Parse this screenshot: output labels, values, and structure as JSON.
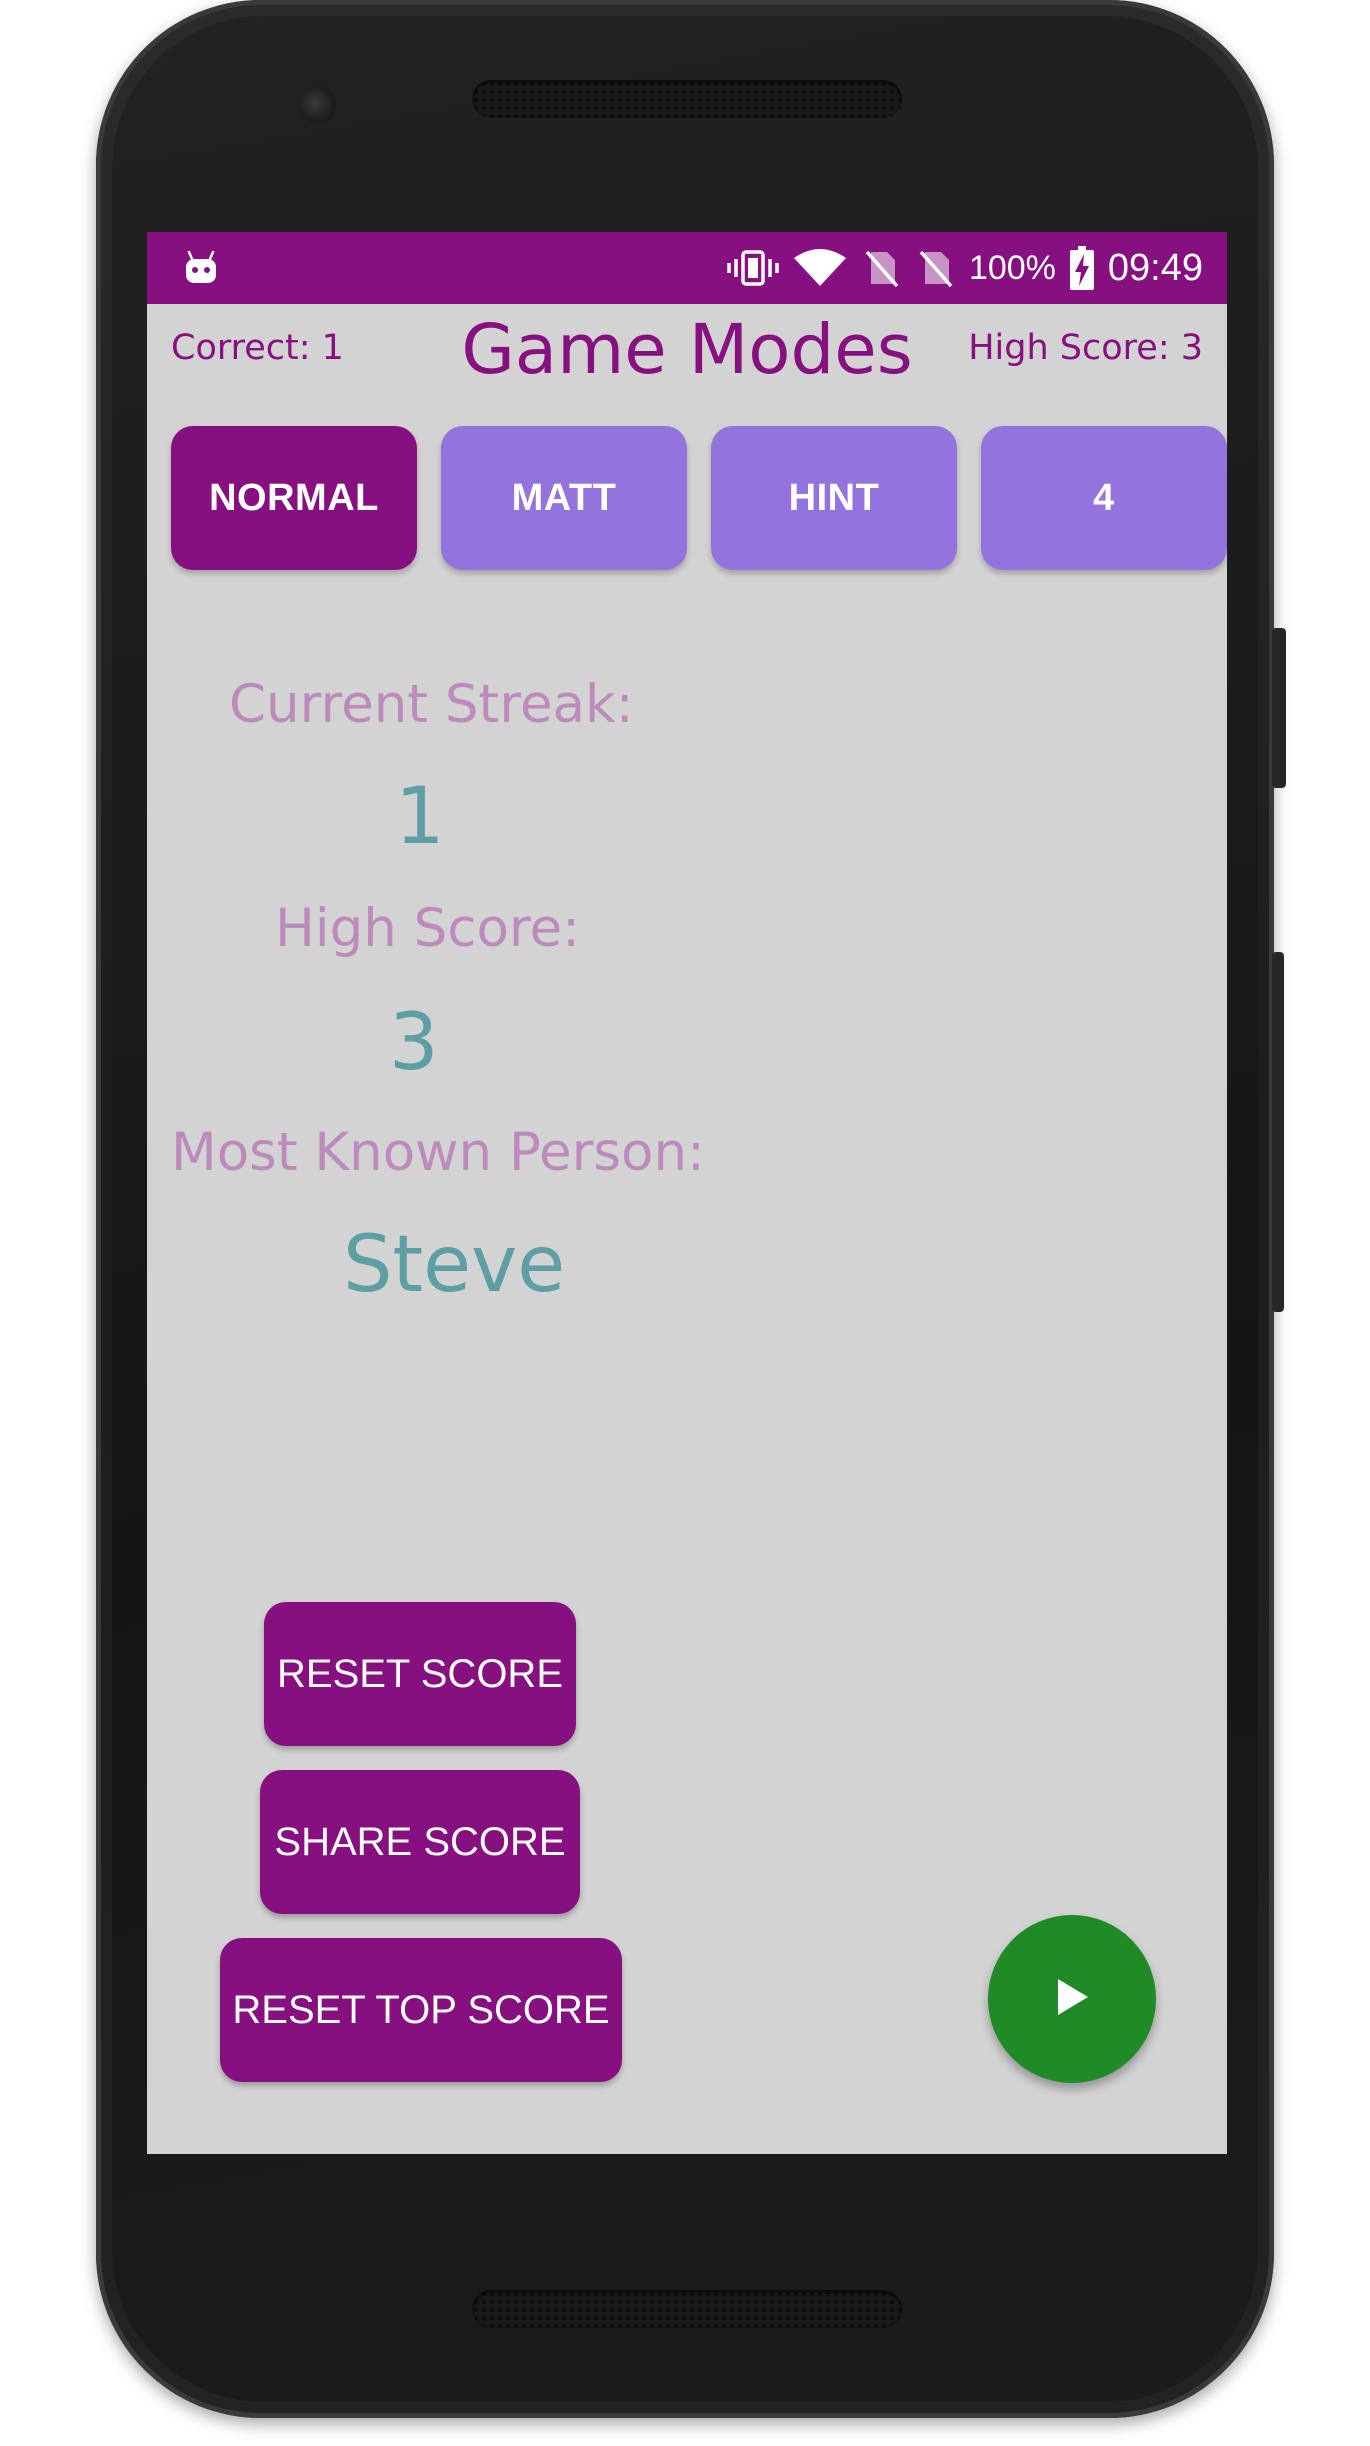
{
  "status_bar": {
    "left_icon": "android-debug-icon",
    "icons": [
      "vibrate-icon",
      "wifi-icon",
      "no-sim-icon",
      "no-sim-icon"
    ],
    "battery_percent": "100%",
    "battery_icon": "battery-charging-icon",
    "time": "09:49"
  },
  "header": {
    "correct_label": "Correct: 1",
    "title": "Game Modes",
    "high_score_label": "High Score: 3"
  },
  "modes": [
    {
      "label": "NORMAL",
      "active": true
    },
    {
      "label": "MATT",
      "active": false
    },
    {
      "label": "HINT",
      "active": false
    },
    {
      "label": "4",
      "active": false
    }
  ],
  "stats": {
    "current_streak_label": "Current Streak:",
    "current_streak_value": "1",
    "high_score_label": "High Score:",
    "high_score_value": "3",
    "most_known_label": "Most Known Person:",
    "most_known_value": "Steve"
  },
  "actions": {
    "reset_score": "RESET SCORE",
    "share_score": "SHARE SCORE",
    "reset_top_score": "RESET TOP SCORE"
  },
  "fab": {
    "icon": "play-icon"
  },
  "colors": {
    "primary": "#86107f",
    "mode_inactive": "#9474dc",
    "label": "#bd8bbb",
    "value": "#5e9fa4",
    "fab": "#1f8a26",
    "background": "#d3d3d3"
  }
}
